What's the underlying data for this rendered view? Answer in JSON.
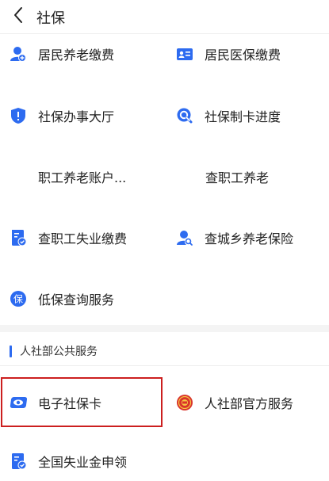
{
  "header": {
    "title": "社保"
  },
  "grid": [
    {
      "label": "居民养老缴费",
      "icon": "person-plus-icon"
    },
    {
      "label": "居民医保缴费",
      "icon": "id-card-icon"
    },
    {
      "label": "社保办事大厅",
      "icon": "shield-icon"
    },
    {
      "label": "社保制卡进度",
      "icon": "search-card-icon"
    },
    {
      "label": "职工养老账户...",
      "icon": ""
    },
    {
      "label": "查职工养老",
      "icon": ""
    },
    {
      "label": "查职工失业缴费",
      "icon": "document-check-icon"
    },
    {
      "label": "查城乡养老保险",
      "icon": "person-search-icon"
    },
    {
      "label": "低保查询服务",
      "icon": "bao-badge-icon"
    }
  ],
  "section": {
    "title": "人社部公共服务",
    "items": [
      {
        "label": "电子社保卡",
        "icon": "eye-card-icon"
      },
      {
        "label": "人社部官方服务",
        "icon": "emblem-icon"
      },
      {
        "label": "全国失业金申领",
        "icon": "document-check-icon"
      }
    ]
  },
  "colors": {
    "accent": "#2d6bf0",
    "highlight": "#cc1f1f",
    "emblem": "#d9342b"
  }
}
